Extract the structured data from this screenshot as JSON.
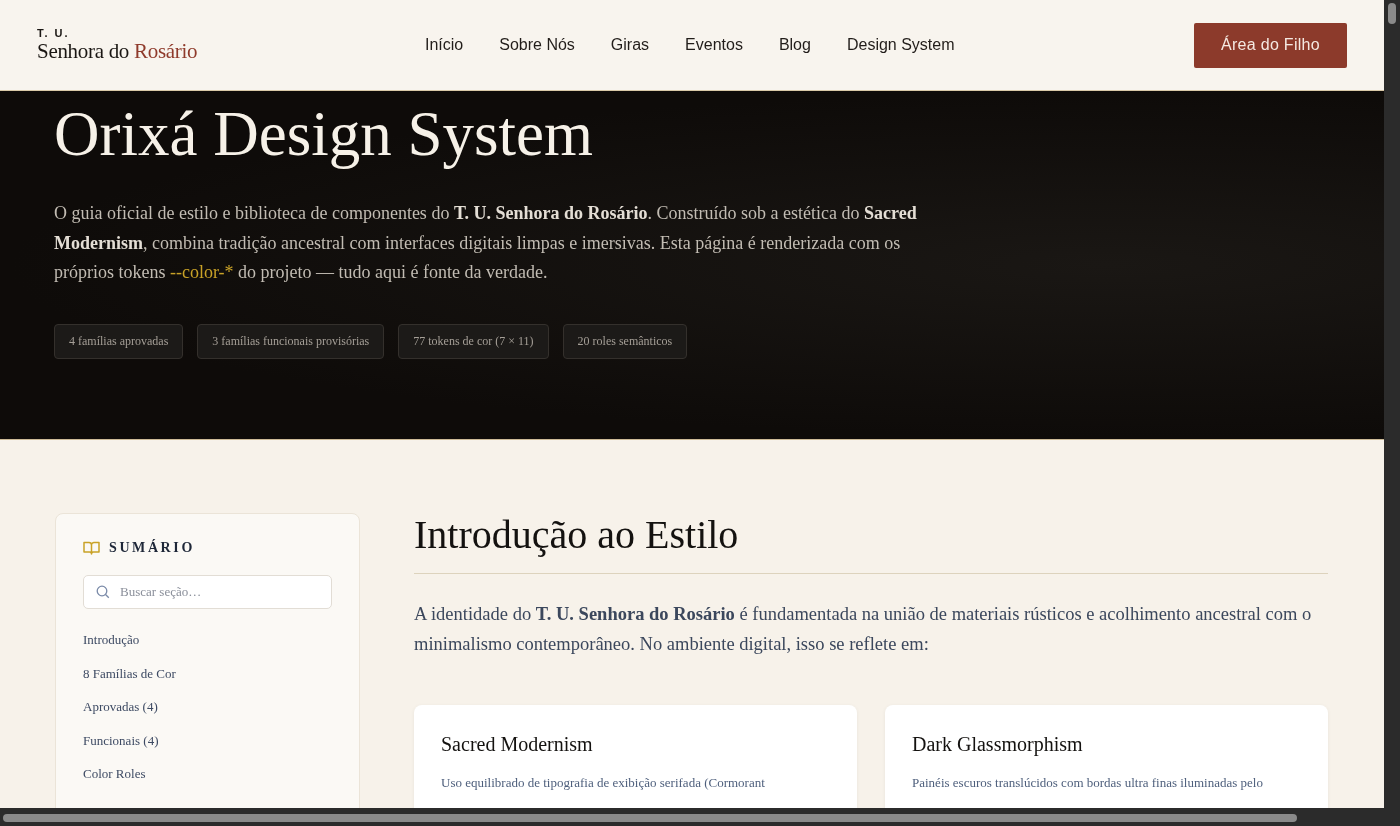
{
  "header": {
    "logo": {
      "top": "T. U.",
      "name": "Senhora do",
      "accent": "Rosário"
    },
    "nav": [
      {
        "label": "Início"
      },
      {
        "label": "Sobre Nós"
      },
      {
        "label": "Giras"
      },
      {
        "label": "Eventos"
      },
      {
        "label": "Blog"
      },
      {
        "label": "Design System"
      }
    ],
    "cta": "Área do Filho"
  },
  "hero": {
    "title": "Orixá Design System",
    "intro": [
      {
        "kind": "plain",
        "text": "O guia oficial de estilo e biblioteca de componentes do "
      },
      {
        "kind": "bold",
        "text": "T. U. Senhora do Rosário"
      },
      {
        "kind": "plain",
        "text": ". Construído sob a estética do "
      },
      {
        "kind": "bold",
        "text": "Sacred Modernism"
      },
      {
        "kind": "plain",
        "text": ", combina tradição ancestral com interfaces digitais limpas e imersivas. Esta página é renderizada com os próprios tokens "
      },
      {
        "kind": "token",
        "text": "--color-*"
      },
      {
        "kind": "plain",
        "text": " do projeto — tudo aqui é fonte da verdade."
      }
    ],
    "chips": [
      "4 famílias aprovadas",
      "3 famílias funcionais provisórias",
      "77 tokens de cor (7 × 11)",
      "20 roles semânticos"
    ]
  },
  "sidebar": {
    "title": "SUMÁRIO",
    "search": {
      "placeholder": "Buscar seção…"
    },
    "items": [
      {
        "label": "Introdução"
      },
      {
        "label": "8 Famílias de Cor"
      },
      {
        "label": "Aprovadas (4)"
      },
      {
        "label": "Funcionais (4)"
      },
      {
        "label": "Color Roles"
      }
    ]
  },
  "section": {
    "title": "Introdução ao Estilo",
    "lead": "A identidade do **T. U. Senhora do Rosário** é fundamentada na união de materiais rústicos e acolhimento ancestral com o minimalismo contemporâneo. No ambiente digital, isso se reflete em:",
    "cards": [
      {
        "title": "Sacred Modernism",
        "text": "Uso equilibrado de tipografia de exibição serifada (Cormorant"
      },
      {
        "title": "Dark Glassmorphism",
        "text": "Painéis escuros translúcidos com bordas ultra finas iluminadas pelo"
      }
    ]
  }
}
